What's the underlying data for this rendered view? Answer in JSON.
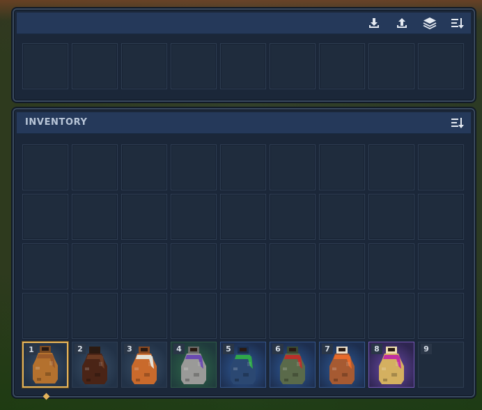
{
  "top_panel": {
    "icons": [
      "download-icon",
      "upload-icon",
      "layers-icon",
      "sort-icon"
    ],
    "slot_count": 9
  },
  "inventory": {
    "title": "INVENTORY",
    "icons": [
      "sort-icon"
    ],
    "storage_rows": 4,
    "storage_cols": 9
  },
  "hotbar": {
    "selected_slot": 1,
    "slots": [
      {
        "number": "1",
        "item": "brown-potion-flask",
        "rarity": "common",
        "colors": {
          "body": "#b4712e",
          "neck": "#7a4a22",
          "scarf": "#9b5a2a"
        }
      },
      {
        "number": "2",
        "item": "dark-brown-potion-flask",
        "rarity": "common",
        "colors": {
          "body": "#4a2416",
          "neck": "#2d1a10",
          "scarf": "#6b3a22"
        }
      },
      {
        "number": "3",
        "item": "orange-potion-flask-with-ribbon",
        "rarity": "common",
        "colors": {
          "body": "#c96a2c",
          "neck": "#8a4a22",
          "scarf": "#e3e0d6"
        }
      },
      {
        "number": "4",
        "item": "grey-potion-flask-with-purple-scarf",
        "rarity": "uncommon",
        "colors": {
          "body": "#9a9a98",
          "neck": "#6c6c6a",
          "scarf": "#6a4ab0"
        }
      },
      {
        "number": "5",
        "item": "navy-potion-flask-with-green-scarf",
        "rarity": "rare",
        "colors": {
          "body": "#2b4872",
          "neck": "#1b2f4e",
          "scarf": "#2fa74a"
        }
      },
      {
        "number": "6",
        "item": "olive-potion-flask-with-red-scarf",
        "rarity": "rare",
        "colors": {
          "body": "#5a6a4a",
          "neck": "#3a4a32",
          "scarf": "#b8302a"
        }
      },
      {
        "number": "7",
        "item": "copper-potion-flask-with-orange-scarf",
        "rarity": "rare",
        "colors": {
          "body": "#a65a32",
          "neck": "#e8dcc8",
          "scarf": "#e76a2a"
        }
      },
      {
        "number": "8",
        "item": "golden-potion-flask-with-magenta-scarf",
        "rarity": "epic",
        "colors": {
          "body": "#d4b060",
          "neck": "#f0e0b0",
          "scarf": "#c030a0"
        }
      },
      {
        "number": "9",
        "item": "",
        "rarity": "",
        "colors": {}
      }
    ]
  },
  "colors": {
    "panel_bg": "#1b2739",
    "header_bg": "#25395a",
    "slot_bg": "#1f2c3d",
    "selected_border": "#e3b35b",
    "title_text": "#b9c6d8"
  }
}
